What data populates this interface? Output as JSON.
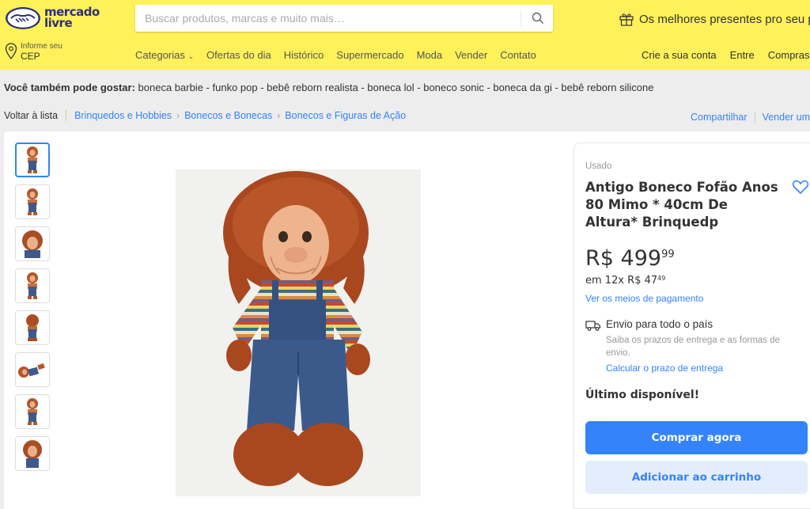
{
  "header": {
    "logo_line1": "mercado",
    "logo_line2": "livre",
    "search_placeholder": "Buscar produtos, marcas e muito mais…",
    "promo_text": "Os melhores presentes pro seu p",
    "cep_small": "Informe seu",
    "cep_big": "CEP",
    "nav": [
      "Categorias",
      "Ofertas do dia",
      "Histórico",
      "Supermercado",
      "Moda",
      "Vender",
      "Contato"
    ],
    "account": [
      "Crie a sua conta",
      "Entre",
      "Compras"
    ],
    "colors": {
      "bar": "#fff159",
      "brand": "#2d3277"
    }
  },
  "recommendations": {
    "label": "Você também pode gostar:",
    "items": [
      "boneca barbie",
      "funko pop",
      "bebê reborn realista",
      "boneca lol",
      "boneco sonic",
      "boneca da gi",
      "bebê reborn silicone"
    ]
  },
  "breadcrumb": {
    "back": "Voltar à lista",
    "path": [
      "Brinquedos e Hobbies",
      "Bonecos e Bonecas",
      "Bonecos e Figuras de Ação"
    ],
    "share": "Compartilhar",
    "sell": "Vender um"
  },
  "gallery": {
    "thumb_count": 8,
    "active_index": 0
  },
  "product": {
    "condition": "Usado",
    "title": "Antigo Boneco Fofão Anos 80 Mimo * 40cm De Altura* Brinquedp",
    "price_currency": "R$",
    "price_int": "499",
    "price_cents": "99",
    "installments_prefix": "em 12x R$ ",
    "installments_int": "47",
    "installments_cents": "49",
    "payment_link": "Ver os meios de pagamento",
    "shipping_title": "Envio para todo o país",
    "shipping_sub": "Saiba os prazos de entrega e as formas de envio.",
    "shipping_link": "Calcular o prazo de entrega",
    "stock": "Último disponível!",
    "buy_label": "Comprar agora",
    "cart_label": "Adicionar ao carrinho",
    "accent": "#3483fa"
  }
}
